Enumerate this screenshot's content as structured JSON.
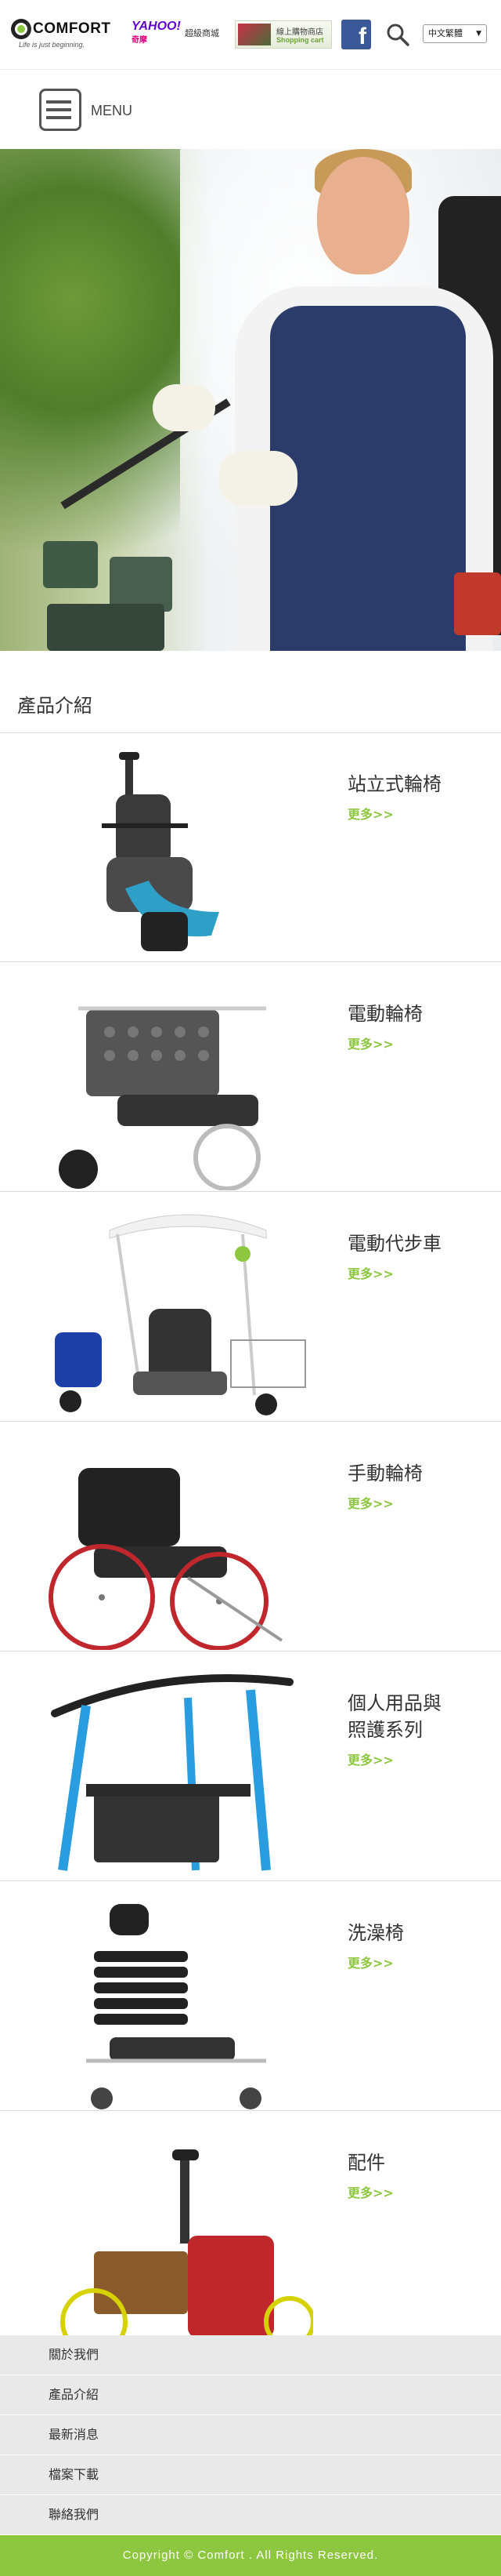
{
  "header": {
    "logo": {
      "brand": "COMFORT",
      "tagline": "Life is just beginning."
    },
    "yahoo": {
      "brand": "YAHOO!",
      "sub": "奇摩",
      "label": "超級商城"
    },
    "shop": {
      "line1": "線上購物商店",
      "line2": "Shopping cart"
    },
    "facebook": {
      "glyph": "f"
    },
    "language": {
      "selected": "中文繁體",
      "caret": "▼"
    }
  },
  "menubar": {
    "label": "MENU"
  },
  "products_section": {
    "title": "產品介紹"
  },
  "products": [
    {
      "name": "站立式輪椅",
      "more": "更多>>"
    },
    {
      "name": "電動輪椅",
      "more": "更多>>"
    },
    {
      "name": "電動代步車",
      "more": "更多>>"
    },
    {
      "name": "手動輪椅",
      "more": "更多>>"
    },
    {
      "name": "個人用品與照護系列",
      "name_line1": "個人用品與",
      "name_line2": "照護系列",
      "more": "更多>>"
    },
    {
      "name": "洗澡椅",
      "more": "更多>>"
    },
    {
      "name": "配件",
      "more": "更多>>"
    }
  ],
  "footer": {
    "nav": [
      "關於我們",
      "產品介紹",
      "最新消息",
      "檔案下載",
      "聯絡我們"
    ],
    "copyright": "Copyright © Comfort . All Rights Reserved."
  },
  "colors": {
    "accent": "#8dc63f",
    "footer_bg": "#e9e9e9",
    "facebook": "#3b5998"
  }
}
